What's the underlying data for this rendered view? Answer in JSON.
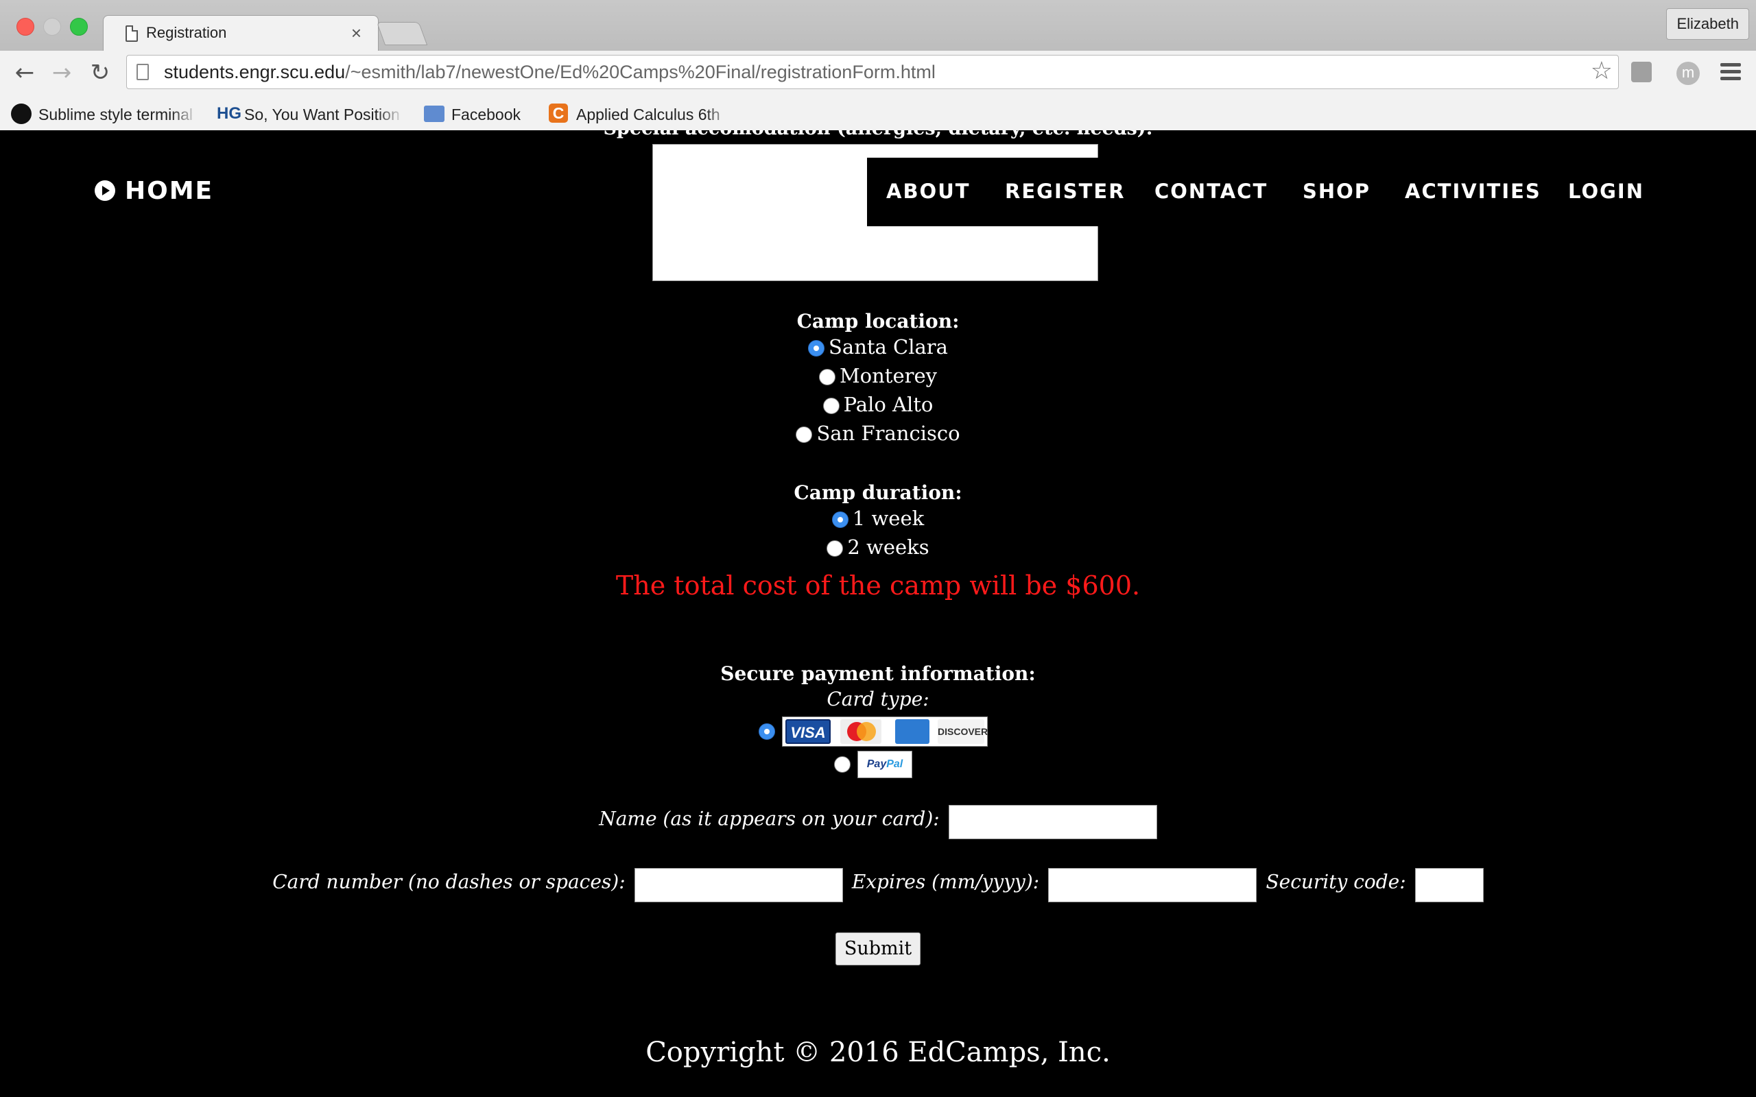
{
  "browser": {
    "tab_title": "Registration",
    "tab_close": "×",
    "profile": "Elizabeth",
    "url_host": "students.engr.scu.edu",
    "url_path": "/~esmith/lab7/newestOne/Ed%20Camps%20Final/registrationForm.html",
    "back": "←",
    "forward": "→",
    "reload": "↻",
    "star": "☆",
    "ext_letter": "m",
    "bookmarks": [
      {
        "label": "Sublime style terminal",
        "icon": "github-icon"
      },
      {
        "label": "So, You Want Position",
        "icon": "hg-icon",
        "icon_text": "HG"
      },
      {
        "label": "Facebook",
        "icon": "folder-icon"
      },
      {
        "label": "Applied Calculus 6th",
        "icon": "c-icon",
        "icon_text": "C"
      }
    ]
  },
  "site_nav": {
    "home": "HOME",
    "items": [
      "ABOUT",
      "REGISTER",
      "CONTACT",
      "SHOP",
      "ACTIVITIES",
      "LOGIN"
    ]
  },
  "form": {
    "accommodation_label": "Special accomodation (allergies, dietary, etc. needs):",
    "location": {
      "label": "Camp location:",
      "options": [
        "Santa Clara",
        "Monterey",
        "Palo Alto",
        "San Francisco"
      ],
      "selected": "Santa Clara"
    },
    "duration": {
      "label": "Camp duration:",
      "options": [
        "1 week",
        "2 weeks"
      ],
      "selected": "1 week"
    },
    "cost_message": "The total cost of the camp will be $600.",
    "payment": {
      "label": "Secure payment information:",
      "card_type_label": "Card type:",
      "card_logos": [
        "VISA",
        "MasterCard",
        "AMEX",
        "DISCOVER"
      ],
      "paypal_logo_a": "Pay",
      "paypal_logo_b": "Pal",
      "selected": "cards"
    },
    "name_label": "Name (as it appears on your card):",
    "card_number_label": "Card number (no dashes or spaces):",
    "expires_label": "Expires (mm/yyyy):",
    "security_label": "Security code:",
    "submit": "Submit"
  },
  "footer": "Copyright © 2016 EdCamps, Inc.",
  "colors": {
    "page_bg": "#000000",
    "cost_text": "#ff1a1a",
    "radio_checked": "#3b8ff0"
  }
}
